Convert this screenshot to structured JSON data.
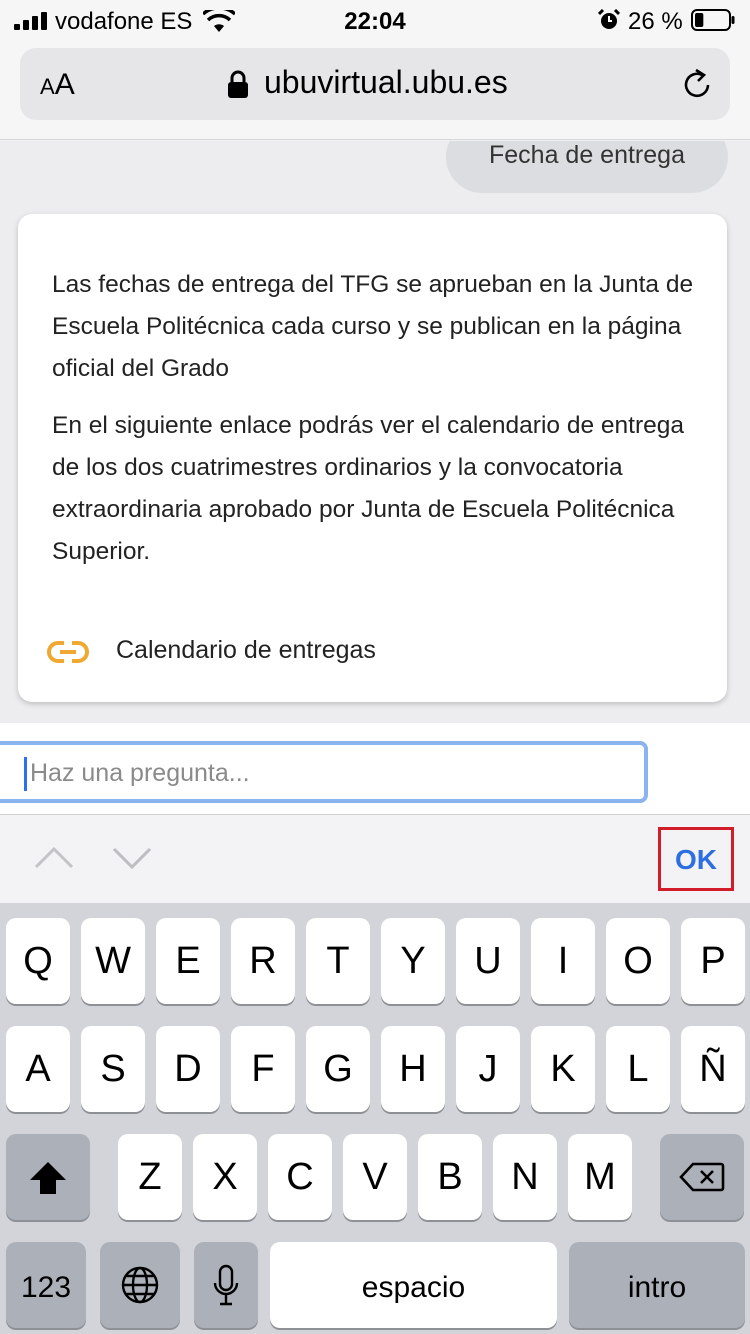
{
  "status_bar": {
    "carrier": "vodafone ES",
    "time": "22:04",
    "battery_percent": "26 %",
    "signal_icon": "signal-bars-icon",
    "wifi_icon": "wifi-icon",
    "alarm_icon": "alarm-icon",
    "battery_icon": "battery-icon",
    "battery_level": 0.26
  },
  "browser": {
    "text_size_small": "A",
    "text_size_large": "A",
    "url": "ubuvirtual.ubu.es",
    "lock_icon": "lock-icon",
    "reload_icon": "reload-icon"
  },
  "chat": {
    "user_message": "Fecha de entrega",
    "bot_paragraph_1": "Las fechas de entrega del TFG se aprueban en la Junta de Escuela Politécnica cada curso y se publican en la página oficial del Grado",
    "bot_paragraph_2": "En el siguiente enlace podrás ver el calendario de entrega de los dos cuatrimestres ordinarios y la convocatoria extraordinaria aprobado por Junta de Escuela Politécnica Superior.",
    "link_label": "Calendario de entregas",
    "link_icon": "link-icon",
    "link_icon_color": "#f0a930"
  },
  "input": {
    "placeholder": "Haz una pregunta..."
  },
  "accessory_bar": {
    "ok_label": "OK",
    "highlight_color": "#d21c2a",
    "ok_color": "#2d6fe0"
  },
  "keyboard": {
    "row1": [
      "Q",
      "W",
      "E",
      "R",
      "T",
      "Y",
      "U",
      "I",
      "O",
      "P"
    ],
    "row2": [
      "A",
      "S",
      "D",
      "F",
      "G",
      "H",
      "J",
      "K",
      "L",
      "Ñ"
    ],
    "row3": [
      "Z",
      "X",
      "C",
      "V",
      "B",
      "N",
      "M"
    ],
    "numbers_key": "123",
    "space_key": "espacio",
    "return_key": "intro",
    "shift_icon": "shift-icon",
    "backspace_icon": "backspace-icon",
    "globe_icon": "globe-icon",
    "microphone_icon": "microphone-icon"
  }
}
